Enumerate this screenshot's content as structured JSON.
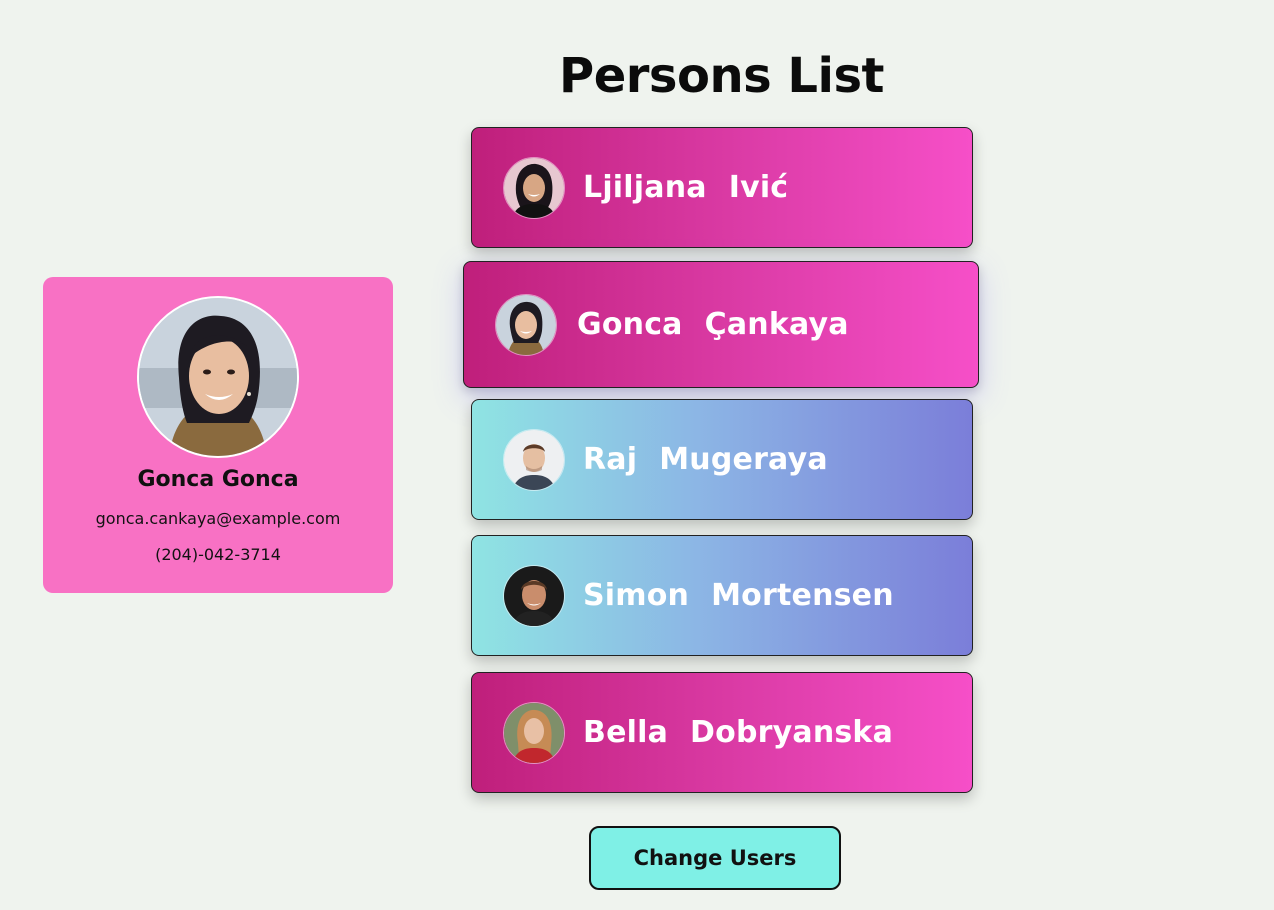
{
  "page": {
    "title": "Persons List"
  },
  "detail": {
    "name": "Gonca Gonca",
    "email": "gonca.cankaya@example.com",
    "phone": "(204)-042-3714"
  },
  "persons": [
    {
      "first": "Ljiljana",
      "last": "Ivić",
      "style": "pink"
    },
    {
      "first": "Gonca",
      "last": "Çankaya",
      "style": "pink"
    },
    {
      "first": "Raj",
      "last": "Mugeraya",
      "style": "blue"
    },
    {
      "first": "Simon",
      "last": "Mortensen",
      "style": "blue"
    },
    {
      "first": "Bella",
      "last": "Dobryanska",
      "style": "pink"
    }
  ],
  "actions": {
    "change_users_label": "Change Users"
  },
  "colors": {
    "background": "#eff3ee",
    "detail_card": "#f871c4",
    "pink_gradient": [
      "#bf1f7b",
      "#f64fc8"
    ],
    "blue_gradient": [
      "#8fe4e3",
      "#7b7ed9"
    ],
    "button": "#7ff0e6"
  }
}
